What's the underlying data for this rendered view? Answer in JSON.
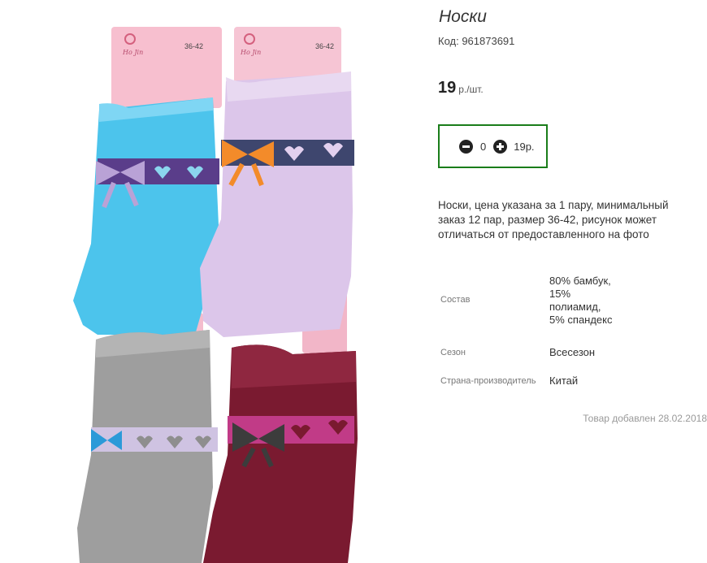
{
  "product": {
    "title": "Носки",
    "code_label": "Код: 961873691",
    "price_value": "19",
    "price_unit": "р./шт.",
    "description": "Носки, цена указана за 1 пару, минимальный заказ 12 пар, размер 36-42, рисунок может отличаться от предоставленного на фото",
    "added": "Товар добавлен 28.02.2018"
  },
  "cart": {
    "quantity": "0",
    "line_total": "19р.",
    "border_color": "#1a7d1a"
  },
  "properties": [
    {
      "label": "Состав",
      "value": "80% бамбук, 15% полиамид, 5% спандекс"
    },
    {
      "label": "Сезон",
      "value": "Всесезон"
    },
    {
      "label": "Страна-производитель",
      "value": "Китай"
    }
  ],
  "image": {
    "tag_size_text": "36-42",
    "tag_brand_text": "Ho Jin",
    "sock_colors": {
      "blue": "#4cc4ec",
      "lilac": "#dcc6ea",
      "grey": "#9e9e9e",
      "burgundy": "#7a1a30"
    }
  }
}
